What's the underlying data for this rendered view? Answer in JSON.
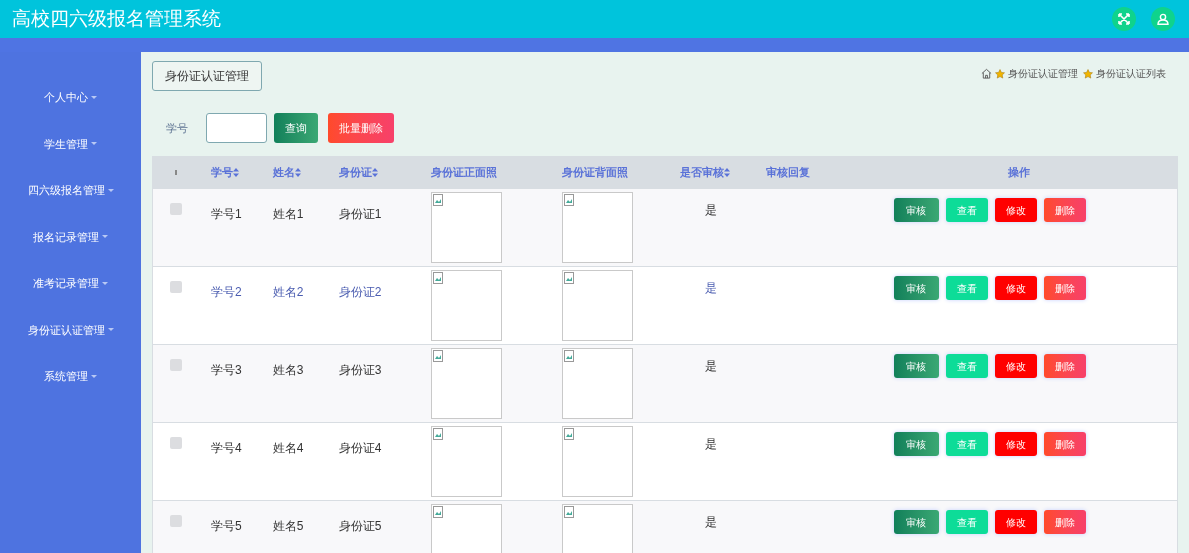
{
  "header": {
    "title": "高校四六级报名管理系统"
  },
  "sidebar": {
    "items": [
      {
        "label": "个人中心"
      },
      {
        "label": "学生管理"
      },
      {
        "label": "四六级报名管理"
      },
      {
        "label": "报名记录管理"
      },
      {
        "label": "准考记录管理"
      },
      {
        "label": "身份证认证管理"
      },
      {
        "label": "系统管理"
      }
    ]
  },
  "page_title": "身份证认证管理",
  "breadcrumb": [
    "身份证认证管理",
    "身份证认证列表"
  ],
  "search": {
    "label": "学号",
    "query_button": "查询",
    "batch_delete_button": "批量删除"
  },
  "table": {
    "columns": [
      {
        "label": "学号",
        "sortable": true
      },
      {
        "label": "姓名",
        "sortable": true
      },
      {
        "label": "身份证",
        "sortable": true
      },
      {
        "label": "身份证正面照",
        "sortable": false
      },
      {
        "label": "身份证背面照",
        "sortable": false
      },
      {
        "label": "是否审核",
        "sortable": true
      },
      {
        "label": "审核回复",
        "sortable": false
      },
      {
        "label": "操作",
        "sortable": false
      }
    ],
    "rows": [
      {
        "checked": false,
        "hovered": false,
        "cells": [
          "学号1",
          "姓名1",
          "身份证1"
        ],
        "audited": "是",
        "actions": [
          {
            "kind": "audit",
            "label": "审核"
          },
          {
            "kind": "view",
            "label": "查看"
          },
          {
            "kind": "edit",
            "label": "修改"
          },
          {
            "kind": "delete",
            "label": "删除"
          }
        ]
      },
      {
        "checked": false,
        "hovered": true,
        "cells": [
          "学号2",
          "姓名2",
          "身份证2"
        ],
        "audited": "是",
        "actions": [
          {
            "kind": "audit",
            "label": "审核"
          },
          {
            "kind": "view",
            "label": "查看"
          },
          {
            "kind": "edit",
            "label": "修改"
          },
          {
            "kind": "delete",
            "label": "删除"
          }
        ]
      },
      {
        "checked": false,
        "hovered": false,
        "cells": [
          "学号3",
          "姓名3",
          "身份证3"
        ],
        "audited": "是",
        "actions": [
          {
            "kind": "audit",
            "label": "审核"
          },
          {
            "kind": "view",
            "label": "查看"
          },
          {
            "kind": "edit",
            "label": "修改"
          },
          {
            "kind": "delete",
            "label": "删除"
          }
        ]
      },
      {
        "checked": false,
        "hovered": false,
        "cells": [
          "学号4",
          "姓名4",
          "身份证4"
        ],
        "audited": "是",
        "actions": [
          {
            "kind": "audit",
            "label": "审核"
          },
          {
            "kind": "view",
            "label": "查看"
          },
          {
            "kind": "edit",
            "label": "修改"
          },
          {
            "kind": "delete",
            "label": "删除"
          }
        ]
      },
      {
        "checked": false,
        "hovered": false,
        "cells": [
          "学号5",
          "姓名5",
          "身份证5"
        ],
        "audited": "是",
        "actions": [
          {
            "kind": "audit",
            "label": "审核"
          },
          {
            "kind": "view",
            "label": "查看"
          },
          {
            "kind": "edit",
            "label": "修改"
          },
          {
            "kind": "delete",
            "label": "删除"
          }
        ]
      }
    ]
  }
}
